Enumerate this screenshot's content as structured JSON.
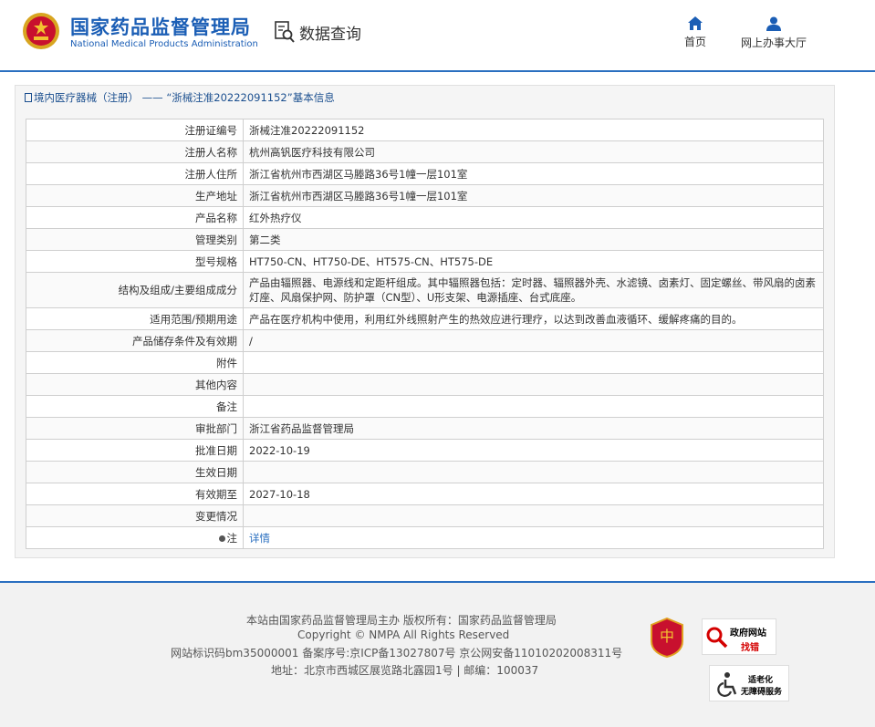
{
  "header": {
    "logo_cn": "国家药品监督管理局",
    "logo_en": "National Medical Products Administration",
    "query_label": "数据查询",
    "nav": [
      {
        "label": "首页",
        "icon": "home-icon"
      },
      {
        "label": "网上办事大厅",
        "icon": "user-icon"
      }
    ]
  },
  "breadcrumb": {
    "category": "境内医疗器械（注册）",
    "separator": " —— ",
    "title": "“浙械注准20222091152”基本信息"
  },
  "table": {
    "rows": [
      {
        "label": "注册证编号",
        "value": "浙械注准20222091152"
      },
      {
        "label": "注册人名称",
        "value": "杭州高钒医疗科技有限公司"
      },
      {
        "label": "注册人住所",
        "value": "浙江省杭州市西湖区马塍路36号1幢一层101室"
      },
      {
        "label": "生产地址",
        "value": "浙江省杭州市西湖区马塍路36号1幢一层101室"
      },
      {
        "label": "产品名称",
        "value": "红外热疗仪"
      },
      {
        "label": "管理类别",
        "value": "第二类"
      },
      {
        "label": "型号规格",
        "value": "HT750-CN、HT750-DE、HT575-CN、HT575-DE"
      },
      {
        "label": "结构及组成/主要组成成分",
        "value": "产品由辐照器、电源线和定距杆组成。其中辐照器包括：定时器、辐照器外壳、水滤镜、卤素灯、固定螺丝、带风扇的卤素灯座、风扇保护网、防护罩（CN型）、U形支架、电源插座、台式底座。"
      },
      {
        "label": "适用范围/预期用途",
        "value": "产品在医疗机构中使用，利用红外线照射产生的热效应进行理疗，以达到改善血液循环、缓解疼痛的目的。"
      },
      {
        "label": "产品储存条件及有效期",
        "value": "/"
      },
      {
        "label": "附件",
        "value": ""
      },
      {
        "label": "其他内容",
        "value": ""
      },
      {
        "label": "备注",
        "value": ""
      },
      {
        "label": "审批部门",
        "value": "浙江省药品监督管理局"
      },
      {
        "label": "批准日期",
        "value": "2022-10-19"
      },
      {
        "label": "生效日期",
        "value": ""
      },
      {
        "label": "有效期至",
        "value": "2027-10-18"
      },
      {
        "label": "变更情况",
        "value": ""
      }
    ],
    "note": {
      "label": "注",
      "link": "详情"
    }
  },
  "footer": {
    "line1": "本站由国家药品监督管理局主办 版权所有：国家药品监督管理局",
    "line2": "Copyright © NMPA All Rights Reserved",
    "line3": "网站标识码bm35000001    备案序号:京ICP备13027807号   京公网安备11010202008311号",
    "line4": "地址：北京市西城区展览路北露园1号 | 邮编：100037",
    "badge_gov_title": "政府网站",
    "badge_gov_sub": "找错",
    "badge_access_1": "适老化",
    "badge_access_2": "无障碍服务"
  },
  "colors": {
    "brand_blue": "#1b5eb5",
    "link_blue": "#2a6fc0",
    "badge_red": "#c8102e"
  }
}
